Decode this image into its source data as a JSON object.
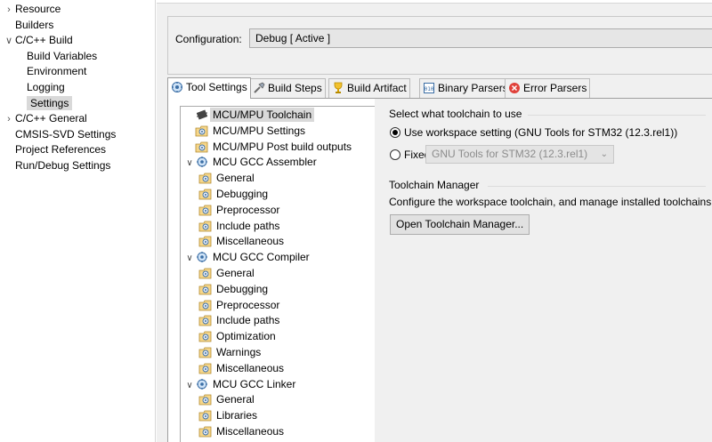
{
  "nav": {
    "items": [
      {
        "label": "Resource",
        "twisty": ">"
      },
      {
        "label": "Builders",
        "twisty": ""
      },
      {
        "label": "C/C++ Build",
        "twisty": "v"
      },
      {
        "label": "Build Variables",
        "twisty": ""
      },
      {
        "label": "Environment",
        "twisty": ""
      },
      {
        "label": "Logging",
        "twisty": ""
      },
      {
        "label": "Settings",
        "twisty": "",
        "selected": true
      },
      {
        "label": "C/C++ General",
        "twisty": ">"
      },
      {
        "label": "CMSIS-SVD Settings",
        "twisty": ""
      },
      {
        "label": "Project References",
        "twisty": ""
      },
      {
        "label": "Run/Debug Settings",
        "twisty": ""
      }
    ]
  },
  "configuration": {
    "label": "Configuration:",
    "value": "Debug  [ Active ]"
  },
  "tabs": [
    {
      "label": "Tool Settings",
      "icon": "tool-settings-icon",
      "active": true
    },
    {
      "label": "Build Steps",
      "icon": "build-steps-icon"
    },
    {
      "label": "Build Artifact",
      "icon": "build-artifact-icon"
    },
    {
      "label": "Binary Parsers",
      "icon": "binary-parsers-icon"
    },
    {
      "label": "Error Parsers",
      "icon": "error-parsers-icon"
    }
  ],
  "tree": {
    "items": [
      {
        "label": "MCU/MPU Toolchain",
        "level": 0,
        "icon": "chip-icon",
        "selected": true
      },
      {
        "label": "MCU/MPU Settings",
        "level": 0,
        "icon": "settings-page-icon"
      },
      {
        "label": "MCU/MPU Post build outputs",
        "level": 0,
        "icon": "settings-page-icon"
      },
      {
        "label": "MCU GCC Assembler",
        "level": 0,
        "icon": "tool-gear-icon",
        "expanded": true
      },
      {
        "label": "General",
        "level": 1,
        "icon": "settings-page-icon"
      },
      {
        "label": "Debugging",
        "level": 1,
        "icon": "settings-page-icon"
      },
      {
        "label": "Preprocessor",
        "level": 1,
        "icon": "settings-page-icon"
      },
      {
        "label": "Include paths",
        "level": 1,
        "icon": "settings-page-icon"
      },
      {
        "label": "Miscellaneous",
        "level": 1,
        "icon": "settings-page-icon"
      },
      {
        "label": "MCU GCC Compiler",
        "level": 0,
        "icon": "tool-gear-icon",
        "expanded": true
      },
      {
        "label": "General",
        "level": 1,
        "icon": "settings-page-icon"
      },
      {
        "label": "Debugging",
        "level": 1,
        "icon": "settings-page-icon"
      },
      {
        "label": "Preprocessor",
        "level": 1,
        "icon": "settings-page-icon"
      },
      {
        "label": "Include paths",
        "level": 1,
        "icon": "settings-page-icon"
      },
      {
        "label": "Optimization",
        "level": 1,
        "icon": "settings-page-icon"
      },
      {
        "label": "Warnings",
        "level": 1,
        "icon": "settings-page-icon"
      },
      {
        "label": "Miscellaneous",
        "level": 1,
        "icon": "settings-page-icon"
      },
      {
        "label": "MCU GCC Linker",
        "level": 0,
        "icon": "tool-gear-icon",
        "expanded": true
      },
      {
        "label": "General",
        "level": 1,
        "icon": "settings-page-icon"
      },
      {
        "label": "Libraries",
        "level": 1,
        "icon": "settings-page-icon"
      },
      {
        "label": "Miscellaneous",
        "level": 1,
        "icon": "settings-page-icon"
      }
    ]
  },
  "toolchain": {
    "group_title": "Select what toolchain to use",
    "option_workspace": "Use workspace setting (GNU Tools for STM32 (12.3.rel1))",
    "option_fixed": "Fixed",
    "fixed_value": "GNU Tools for STM32 (12.3.rel1)",
    "selected": "workspace"
  },
  "manager": {
    "group_title": "Toolchain Manager",
    "description": "Configure the workspace toolchain, and manage installed toolchains.",
    "button_label": "Open Toolchain Manager..."
  }
}
